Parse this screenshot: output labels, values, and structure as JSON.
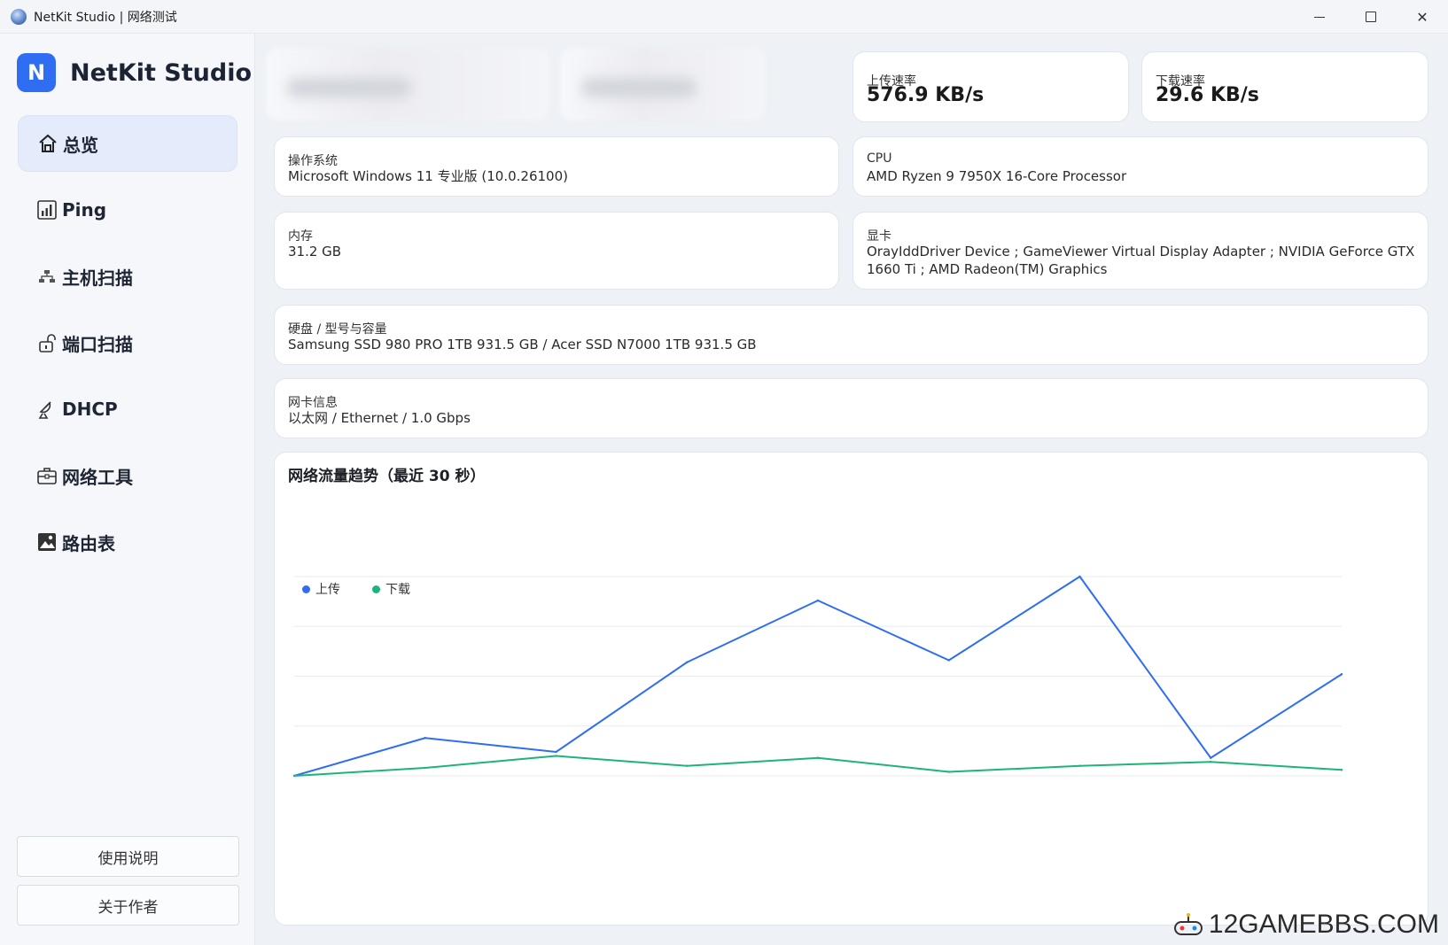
{
  "window": {
    "title": "NetKit Studio | 网络测试",
    "minimize": "—",
    "close": "✕"
  },
  "brand": {
    "logo": "N",
    "name": "NetKit Studio"
  },
  "nav": {
    "items": [
      {
        "label": "总览",
        "icon": "home-icon"
      },
      {
        "label": "Ping",
        "icon": "bar-chart-icon"
      },
      {
        "label": "主机扫描",
        "icon": "network-icon"
      },
      {
        "label": "端口扫描",
        "icon": "unlock-icon"
      },
      {
        "label": "DHCP",
        "icon": "satellite-icon"
      },
      {
        "label": "网络工具",
        "icon": "toolbox-icon"
      },
      {
        "label": "路由表",
        "icon": "image-icon"
      }
    ],
    "active": 0
  },
  "footer_buttons": {
    "manual": "使用说明",
    "about": "关于作者"
  },
  "stats": {
    "upload": {
      "label": "上传速率",
      "value": "576.9 KB/s"
    },
    "download": {
      "label": "下载速率",
      "value": "29.6 KB/s"
    }
  },
  "info": {
    "os": {
      "label": "操作系统",
      "value": "Microsoft Windows 11 专业版 (10.0.26100)"
    },
    "cpu": {
      "label": "CPU",
      "value": "AMD Ryzen 9 7950X 16-Core Processor"
    },
    "memory": {
      "label": "内存",
      "value": "31.2 GB"
    },
    "gpu": {
      "label": "显卡",
      "value": "OrayIddDriver Device ; GameViewer Virtual Display Adapter ; NVIDIA GeForce GTX 1660 Ti ; AMD Radeon(TM) Graphics"
    },
    "disk": {
      "label": "硬盘 / 型号与容量",
      "value": "Samsung SSD 980 PRO 1TB 931.5 GB / Acer SSD N7000 1TB 931.5 GB"
    },
    "nic": {
      "label": "网卡信息",
      "value": "以太网 / Ethernet / 1.0 Gbps"
    }
  },
  "chart_data": {
    "type": "line",
    "title": "网络流量趋势（最近 30 秒）",
    "legend_position": "top-left",
    "grid": true,
    "x": [
      0,
      1,
      2,
      3,
      4,
      5,
      6,
      7,
      8
    ],
    "ylim": [
      0,
      100
    ],
    "series": [
      {
        "name": "上传",
        "color": "#2f6ef2",
        "values": [
          0,
          19,
          12,
          57,
          88,
          58,
          100,
          9,
          51
        ]
      },
      {
        "name": "下载",
        "color": "#1db47a",
        "values": [
          0,
          4,
          10,
          5,
          9,
          2,
          5,
          7,
          3
        ]
      }
    ]
  },
  "watermark": "12GAMEBBS.COM"
}
